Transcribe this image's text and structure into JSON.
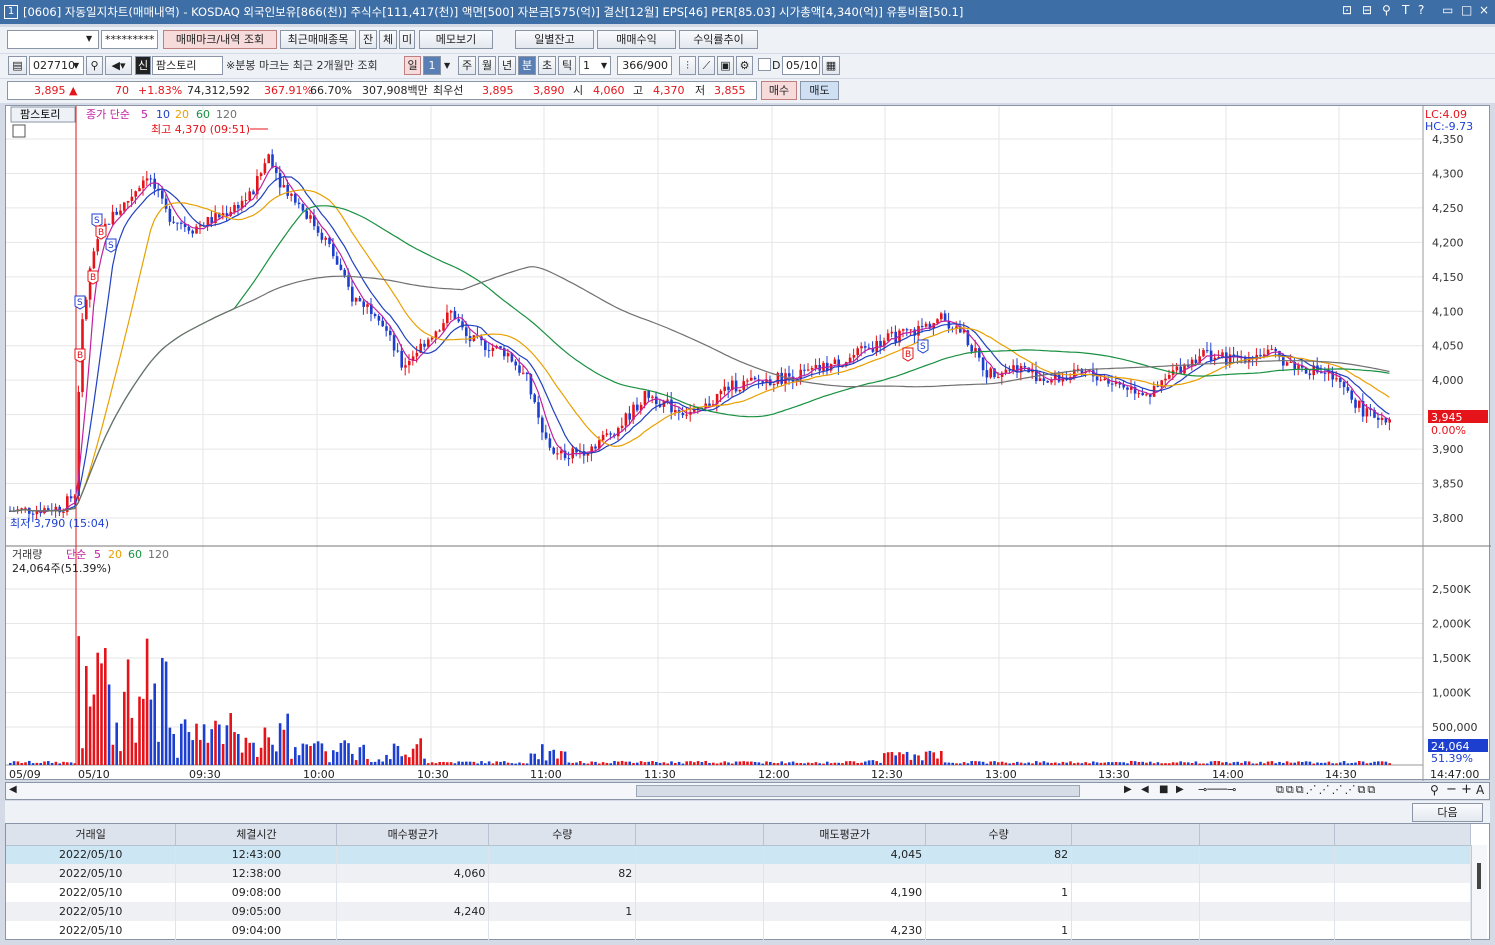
{
  "window": {
    "number": "1",
    "title": "[0606] 자동일지차트(매매내역) - KOSDAQ 외국인보유[866(천)] 주식수[111,417(천)] 액면[500] 자본금[575(억)] 결산[12월] EPS[46] PER[85.03] 시가총액[4,340(억)] 유통비율[50.1]",
    "controls": [
      "⊡",
      "⊟",
      "⚲",
      "T",
      "?",
      "▭",
      "□",
      "×"
    ]
  },
  "row1": {
    "account_value": "",
    "password_mask": "*********",
    "buttons": [
      "매매마크/내역 조회",
      "최근매매종목",
      "잔",
      "체",
      "미",
      "메모보기",
      "일별잔고",
      "매매수익",
      "수익률추이"
    ]
  },
  "row2": {
    "code": "027710",
    "credit_badge": "신",
    "name": "팜스토리",
    "notice": "※분봉 마크는 최근 2개월만 조회",
    "periods": [
      "일",
      "1",
      "주",
      "월",
      "년",
      "분",
      "초",
      "틱"
    ],
    "tick_value": "1",
    "count": "366/900",
    "d_label": "D",
    "date": "05/10"
  },
  "row3": {
    "price": "3,895",
    "arrow": "▲",
    "change": "70",
    "change_pct": "+1.83%",
    "volume": "74,312,592",
    "vol_ratio": "367.91%",
    "turnover": "66.70%",
    "amount": "307,908백만",
    "best_label": "최우선",
    "ask": "3,895",
    "bid": "3,890",
    "open_label": "시",
    "open": "4,060",
    "high_label": "고",
    "high": "4,370",
    "low_label": "저",
    "low": "3,855",
    "buy": "매수",
    "sell": "매도"
  },
  "chart": {
    "name_tag": "팜스토리",
    "legend_prefix": "종가 단순",
    "ma_periods": [
      "5",
      "10",
      "20",
      "60",
      "120"
    ],
    "high_note": "최고 4,370 (09:51)",
    "low_note": "최저 3,790 (15:04)",
    "lc": "LC:4.09",
    "hc": "HC:-9.73",
    "price_ticks": [
      "4,350",
      "4,300",
      "4,250",
      "4,200",
      "4,150",
      "4,100",
      "4,050",
      "4,000",
      "3,950",
      "3,900",
      "3,850",
      "3,800"
    ],
    "current_price": "3,945",
    "current_pct": "0.00%",
    "vol_legend_label": "거래량",
    "vol_legend_prefix": "단순",
    "vol_ma_periods": [
      "5",
      "20",
      "60",
      "120"
    ],
    "vol_note": "24,064주(51.39%)",
    "vol_ticks": [
      "2,500K",
      "2,000K",
      "1,500K",
      "1,000K",
      "500,000"
    ],
    "vol_current": "24,064",
    "vol_current_pct": "51.39%",
    "time_labels": [
      "05/09",
      "05/10",
      "09:30",
      "10:00",
      "10:30",
      "11:00",
      "11:30",
      "12:00",
      "12:30",
      "13:00",
      "13:30",
      "14:00",
      "14:30",
      "14:47:00"
    ],
    "colors": {
      "up": "#e4141a",
      "down": "#1c3fd0",
      "ma5": "#c020a0",
      "ma10": "#2040c0",
      "ma20": "#e8a000",
      "ma60": "#189040",
      "ma120": "#707070"
    }
  },
  "grid": {
    "next_button": "다음",
    "headers": [
      "거래일",
      "체결시간",
      "매수평균가",
      "수량",
      "",
      "매도평균가",
      "수량",
      "",
      "",
      ""
    ],
    "rows": [
      [
        "2022/05/10",
        "12:43:00",
        "",
        "",
        "",
        "4,045",
        "82",
        "",
        "",
        ""
      ],
      [
        "2022/05/10",
        "12:38:00",
        "4,060",
        "82",
        "",
        "",
        "",
        "",
        "",
        ""
      ],
      [
        "2022/05/10",
        "09:08:00",
        "",
        "",
        "",
        "4,190",
        "1",
        "",
        "",
        ""
      ],
      [
        "2022/05/10",
        "09:05:00",
        "4,240",
        "1",
        "",
        "",
        "",
        "",
        "",
        ""
      ],
      [
        "2022/05/10",
        "09:04:00",
        "",
        "",
        "",
        "4,230",
        "1",
        "",
        "",
        ""
      ]
    ]
  }
}
